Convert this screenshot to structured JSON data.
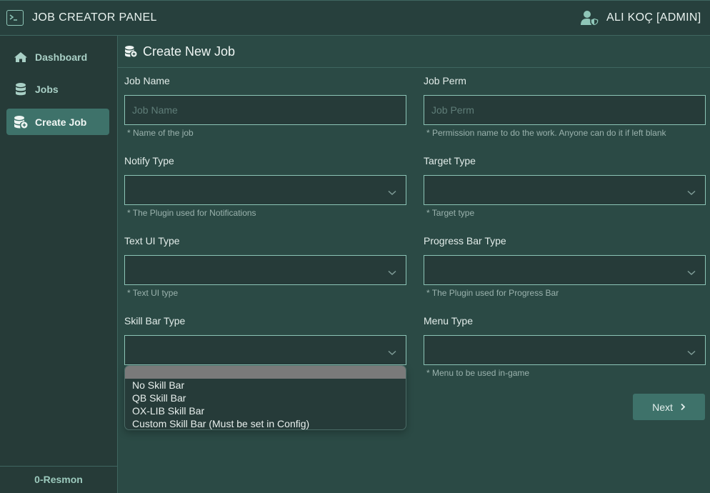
{
  "header": {
    "app_icon": "terminal-icon",
    "title": "JOB CREATOR PANEL",
    "user_icon": "user-shield-icon",
    "user_name": "ALI KOÇ [ADMIN]"
  },
  "sidebar": {
    "items": [
      {
        "label": "Dashboard",
        "icon": "home-icon",
        "active": false
      },
      {
        "label": "Jobs",
        "icon": "database-icon",
        "active": false
      },
      {
        "label": "Create Job",
        "icon": "database-add-icon",
        "active": true
      }
    ],
    "footer": "0-Resmon"
  },
  "page": {
    "icon": "database-add-icon",
    "title": "Create New Job"
  },
  "form": {
    "job_name": {
      "label": "Job Name",
      "placeholder": "Job Name",
      "value": "",
      "help": "* Name of the job"
    },
    "job_perm": {
      "label": "Job Perm",
      "placeholder": "Job Perm",
      "value": "",
      "help": "* Permission name to do the work. Anyone can do it if left blank"
    },
    "notify_type": {
      "label": "Notify Type",
      "value": "",
      "help": "* The Plugin used for Notifications"
    },
    "target_type": {
      "label": "Target Type",
      "value": "",
      "help": "* Target type"
    },
    "text_ui_type": {
      "label": "Text UI Type",
      "value": "",
      "help": "* Text UI type"
    },
    "progress_bar_type": {
      "label": "Progress Bar Type",
      "value": "",
      "help": "* The Plugin used for Progress Bar"
    },
    "skill_bar_type": {
      "label": "Skill Bar Type",
      "value": "",
      "open": true,
      "options": [
        "",
        "No Skill Bar",
        "QB Skill Bar",
        "OX-LIB Skill Bar",
        "Custom Skill Bar (Must be set in Config)"
      ]
    },
    "menu_type": {
      "label": "Menu Type",
      "value": "",
      "help": "* Menu to be used in-game"
    }
  },
  "actions": {
    "next_label": "Next",
    "next_icon": "chevron-right-icon"
  },
  "colors": {
    "background": "#2b4a45",
    "sidebar": "#263b38",
    "accent": "#3e726a",
    "input_border": "#8cc4b6"
  }
}
